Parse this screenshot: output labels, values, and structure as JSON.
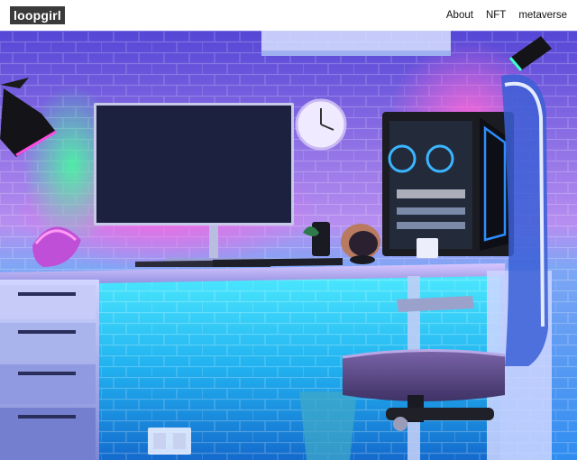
{
  "site": {
    "logo": "loopgirl"
  },
  "nav": {
    "items": [
      {
        "label": "About"
      },
      {
        "label": "NFT"
      },
      {
        "label": "metaverse"
      }
    ]
  },
  "hero": {
    "colors": {
      "wall_top": "#5a4cd8",
      "wall_glow_pink": "#ff4fd8",
      "wall_glow_green": "#3cff9a",
      "wall_bottom": "#2aa8ff",
      "desk_light": "#2fe0ff",
      "monitor_screen": "#1d2140"
    }
  }
}
